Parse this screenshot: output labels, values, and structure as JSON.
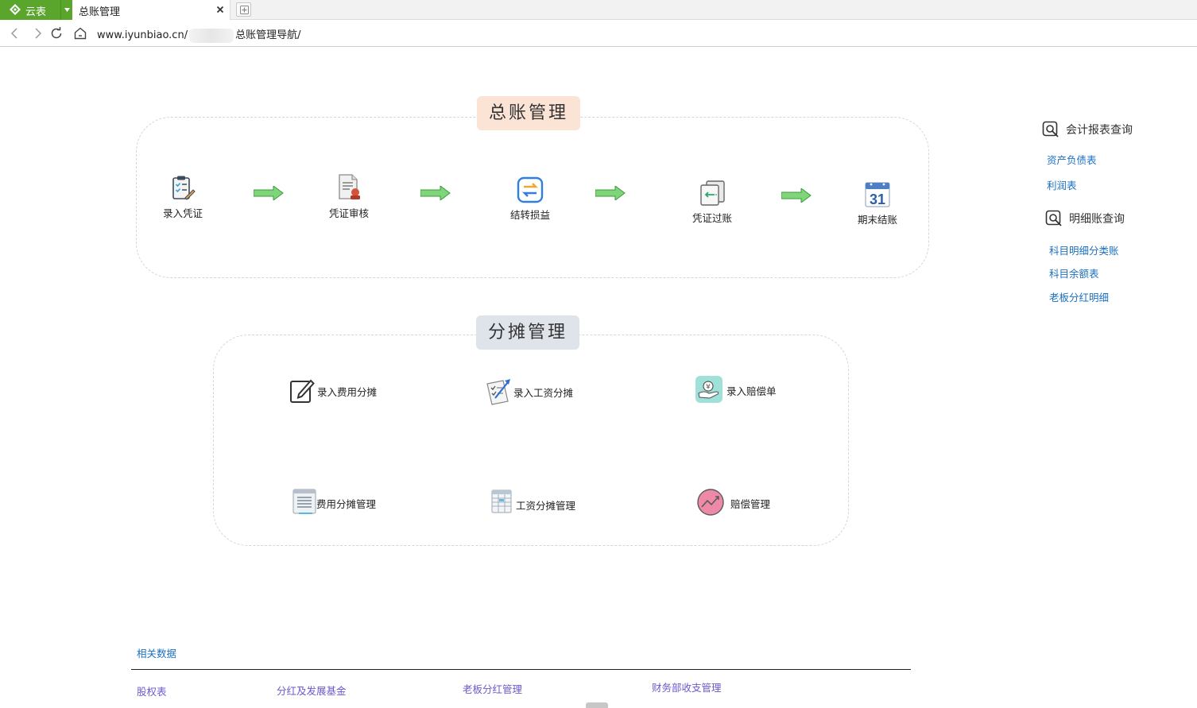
{
  "browser": {
    "brand_name": "云表",
    "brand_color": "#5aa52c",
    "tab_title": "总账管理",
    "url_prefix": "www.iyunbiao.cn/",
    "url_suffix": "总账管理导航/"
  },
  "ledger": {
    "title": "总账管理",
    "title_bg": "#fbe3d6",
    "steps": [
      {
        "label": "录入凭证",
        "icon": "voucher-entry-icon"
      },
      {
        "label": "凭证审核",
        "icon": "voucher-review-icon"
      },
      {
        "label": "结转损益",
        "icon": "profit-transfer-icon"
      },
      {
        "label": "凭证过账",
        "icon": "voucher-posting-icon"
      },
      {
        "label": "期末结账",
        "icon": "calendar-31-icon"
      }
    ],
    "calendar_day": "31"
  },
  "allocation": {
    "title": "分摊管理",
    "title_bg": "#dfe3ea",
    "items": [
      {
        "label": "录入费用分摊",
        "icon": "edit-icon"
      },
      {
        "label": "录入工资分摊",
        "icon": "checklist-icon"
      },
      {
        "label": "录入赔偿单",
        "icon": "money-hand-icon"
      },
      {
        "label": "费用分摊管理",
        "icon": "document-icon"
      },
      {
        "label": "工资分摊管理",
        "icon": "spreadsheet-icon"
      },
      {
        "label": "赔偿管理",
        "icon": "trend-chart-icon"
      }
    ]
  },
  "sidebar": {
    "reports_title": "会计报表查询",
    "reports_links": [
      "资产负债表",
      "利润表"
    ],
    "detail_title": "明细账查询",
    "detail_links": [
      "科目明细分类账",
      "科目余额表",
      "老板分红明细"
    ]
  },
  "related": {
    "title": "相关数据",
    "links": [
      "股权表",
      "分红及发展基金",
      "老板分红管理",
      "财务部收支管理"
    ]
  }
}
